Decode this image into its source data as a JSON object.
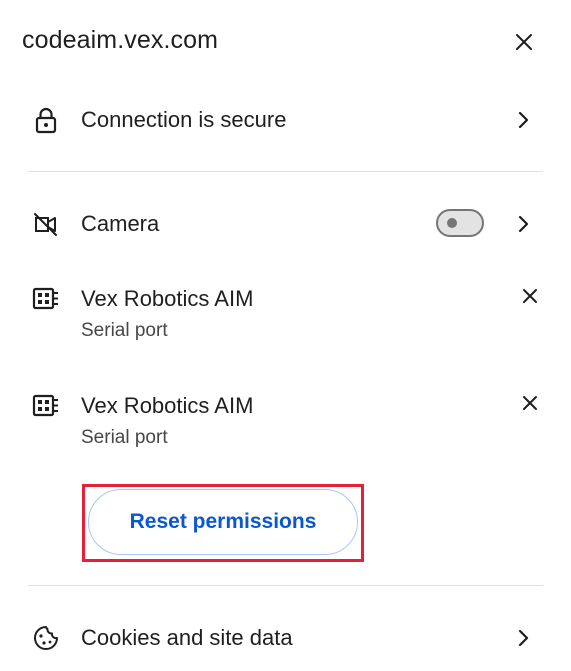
{
  "header": {
    "site": "codeaim.vex.com",
    "close_icon": "close-icon"
  },
  "connection": {
    "label": "Connection is secure",
    "icon": "lock-icon"
  },
  "permissions": {
    "camera": {
      "label": "Camera",
      "icon": "camera-off-icon",
      "toggle_on": false
    },
    "devices": [
      {
        "label": "Vex Robotics AIM",
        "subtitle": "Serial port",
        "icon": "serial-port-icon"
      },
      {
        "label": "Vex Robotics AIM",
        "subtitle": "Serial port",
        "icon": "serial-port-icon"
      }
    ],
    "reset_label": "Reset permissions"
  },
  "cookies": {
    "label": "Cookies and site data",
    "icon": "cookie-icon"
  },
  "colors": {
    "accent": "#0b57d0",
    "divider": "#d3e3fd",
    "highlight": "#e5213a"
  }
}
